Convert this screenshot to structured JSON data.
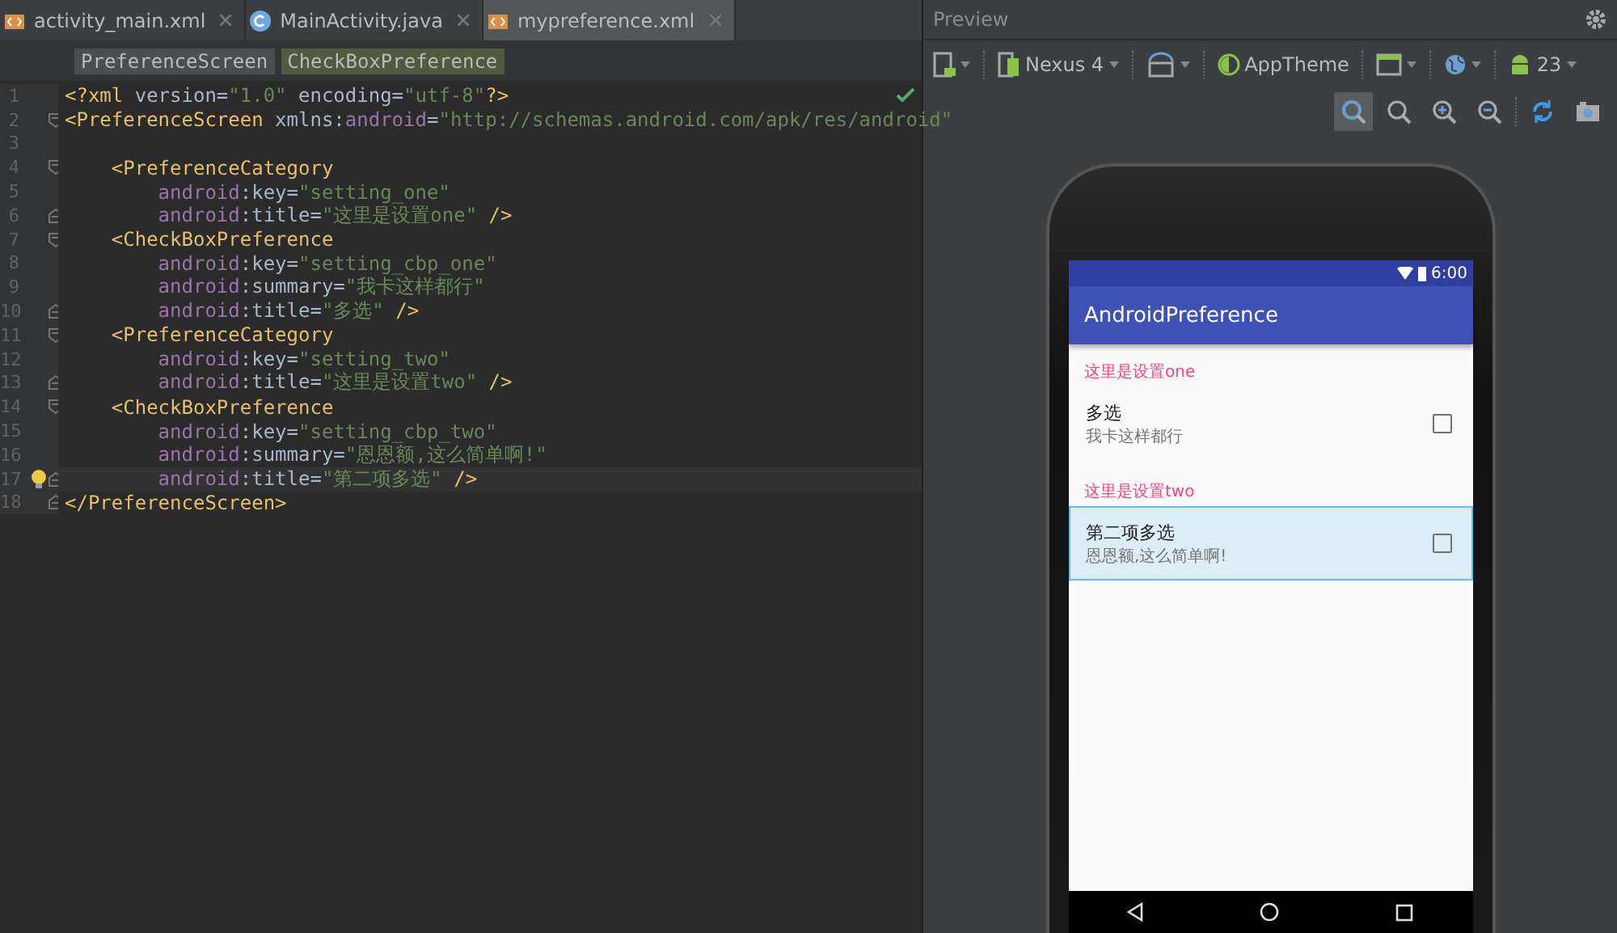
{
  "editor_tabs": [
    {
      "label": "activity_main.xml",
      "kind": "xml",
      "selected": false
    },
    {
      "label": "MainActivity.java",
      "kind": "java",
      "selected": false
    },
    {
      "label": "mypreference.xml",
      "kind": "xml",
      "selected": true
    }
  ],
  "breadcrumbs": [
    {
      "label": "PreferenceScreen",
      "selected": false
    },
    {
      "label": "CheckBoxPreference",
      "selected": true
    }
  ],
  "code_lines": [
    {
      "number": "1",
      "fold_start": false,
      "fold_end": false,
      "current": false,
      "tokens": [
        {
          "kind": "tag",
          "text": "<?xml "
        },
        {
          "kind": "plain",
          "text": "version="
        },
        {
          "kind": "string",
          "text": "\"1.0\""
        },
        {
          "kind": "plain",
          "text": " encoding="
        },
        {
          "kind": "string",
          "text": "\"utf-8\""
        },
        {
          "kind": "tag",
          "text": "?>"
        }
      ]
    },
    {
      "number": "2",
      "fold_start": true,
      "fold_end": false,
      "current": false,
      "tokens": [
        {
          "kind": "tag",
          "text": "<PreferenceScreen "
        },
        {
          "kind": "plain",
          "text": "xmlns:"
        },
        {
          "kind": "ns",
          "text": "android"
        },
        {
          "kind": "plain",
          "text": "="
        },
        {
          "kind": "string",
          "text": "\"http://schemas.android.com/apk/res/android\""
        }
      ]
    },
    {
      "number": "3",
      "fold_start": false,
      "fold_end": false,
      "current": false
    },
    {
      "number": "4",
      "fold_start": true,
      "fold_end": false,
      "current": false,
      "tokens": [
        {
          "kind": "tag",
          "text": "    <PreferenceCategory"
        }
      ]
    },
    {
      "number": "5",
      "fold_start": false,
      "fold_end": false,
      "current": false,
      "tokens": [
        {
          "kind": "ns",
          "text": "        android"
        },
        {
          "kind": "plain",
          "text": ":key="
        },
        {
          "kind": "string",
          "text": "\"setting_one\""
        }
      ]
    },
    {
      "number": "6",
      "fold_start": false,
      "fold_end": true,
      "current": false,
      "tokens": [
        {
          "kind": "ns",
          "text": "        android"
        },
        {
          "kind": "plain",
          "text": ":title="
        },
        {
          "kind": "string",
          "text": "\"这里是设置one\""
        },
        {
          "kind": "tag",
          "text": " />"
        }
      ]
    },
    {
      "number": "7",
      "fold_start": true,
      "fold_end": false,
      "current": false,
      "tokens": [
        {
          "kind": "tag",
          "text": "    <CheckBoxPreference"
        }
      ]
    },
    {
      "number": "8",
      "fold_start": false,
      "fold_end": false,
      "current": false,
      "tokens": [
        {
          "kind": "ns",
          "text": "        android"
        },
        {
          "kind": "plain",
          "text": ":key="
        },
        {
          "kind": "string",
          "text": "\"setting_cbp_one\""
        }
      ]
    },
    {
      "number": "9",
      "fold_start": false,
      "fold_end": false,
      "current": false,
      "tokens": [
        {
          "kind": "ns",
          "text": "        android"
        },
        {
          "kind": "plain",
          "text": ":summary="
        },
        {
          "kind": "string",
          "text": "\"我卡这样都行\""
        }
      ]
    },
    {
      "number": "10",
      "fold_start": false,
      "fold_end": true,
      "current": false,
      "tokens": [
        {
          "kind": "ns",
          "text": "        android"
        },
        {
          "kind": "plain",
          "text": ":title="
        },
        {
          "kind": "string",
          "text": "\"多选\""
        },
        {
          "kind": "tag",
          "text": " />"
        }
      ]
    },
    {
      "number": "11",
      "fold_start": true,
      "fold_end": false,
      "current": false,
      "tokens": [
        {
          "kind": "tag",
          "text": "    <PreferenceCategory"
        }
      ]
    },
    {
      "number": "12",
      "fold_start": false,
      "fold_end": false,
      "current": false,
      "tokens": [
        {
          "kind": "ns",
          "text": "        android"
        },
        {
          "kind": "plain",
          "text": ":key="
        },
        {
          "kind": "string",
          "text": "\"setting_two\""
        }
      ]
    },
    {
      "number": "13",
      "fold_start": false,
      "fold_end": true,
      "current": false,
      "tokens": [
        {
          "kind": "ns",
          "text": "        android"
        },
        {
          "kind": "plain",
          "text": ":title="
        },
        {
          "kind": "string",
          "text": "\"这里是设置two\""
        },
        {
          "kind": "tag",
          "text": " />"
        }
      ]
    },
    {
      "number": "14",
      "fold_start": true,
      "fold_end": false,
      "current": false,
      "tokens": [
        {
          "kind": "tag",
          "text": "    <CheckBoxPreference"
        }
      ]
    },
    {
      "number": "15",
      "fold_start": false,
      "fold_end": false,
      "current": false,
      "tokens": [
        {
          "kind": "ns",
          "text": "        android"
        },
        {
          "kind": "plain",
          "text": ":key="
        },
        {
          "kind": "string",
          "text": "\"setting_cbp_two\""
        }
      ]
    },
    {
      "number": "16",
      "fold_start": false,
      "fold_end": false,
      "current": false,
      "tokens": [
        {
          "kind": "ns",
          "text": "        android"
        },
        {
          "kind": "plain",
          "text": ":summary="
        },
        {
          "kind": "string",
          "text": "\"恩恩额,这么简单啊!\""
        }
      ]
    },
    {
      "number": "17",
      "fold_start": false,
      "fold_end": true,
      "current": true,
      "tokens": [
        {
          "kind": "ns",
          "text": "        android"
        },
        {
          "kind": "plain",
          "text": ":title="
        },
        {
          "kind": "string",
          "text": "\"第二项多选\""
        },
        {
          "kind": "tag",
          "text": " />"
        }
      ]
    },
    {
      "number": "18",
      "fold_start": false,
      "fold_end": true,
      "current": false,
      "tokens": [
        {
          "kind": "tag",
          "text": "</PreferenceScreen>"
        }
      ]
    }
  ],
  "preview": {
    "title": "Preview",
    "device": "Nexus 4",
    "theme": "AppTheme",
    "api_level": "23",
    "zoom_buttons": [
      {
        "selected": true
      },
      {
        "selected": false
      },
      {
        "selected": false
      },
      {
        "selected": false
      }
    ],
    "phone": {
      "time": "6:00",
      "app_title": "AndroidPreference",
      "categories": [
        {
          "title": "这里是设置one",
          "items": [
            {
              "title": "多选",
              "summary": "我卡这样都行",
              "checked": false,
              "selected": false
            }
          ]
        },
        {
          "title": "这里是设置two",
          "items": [
            {
              "title": "第二项多选",
              "summary": "恩恩额,这么简单啊!",
              "checked": false,
              "selected": true
            }
          ]
        }
      ]
    }
  }
}
